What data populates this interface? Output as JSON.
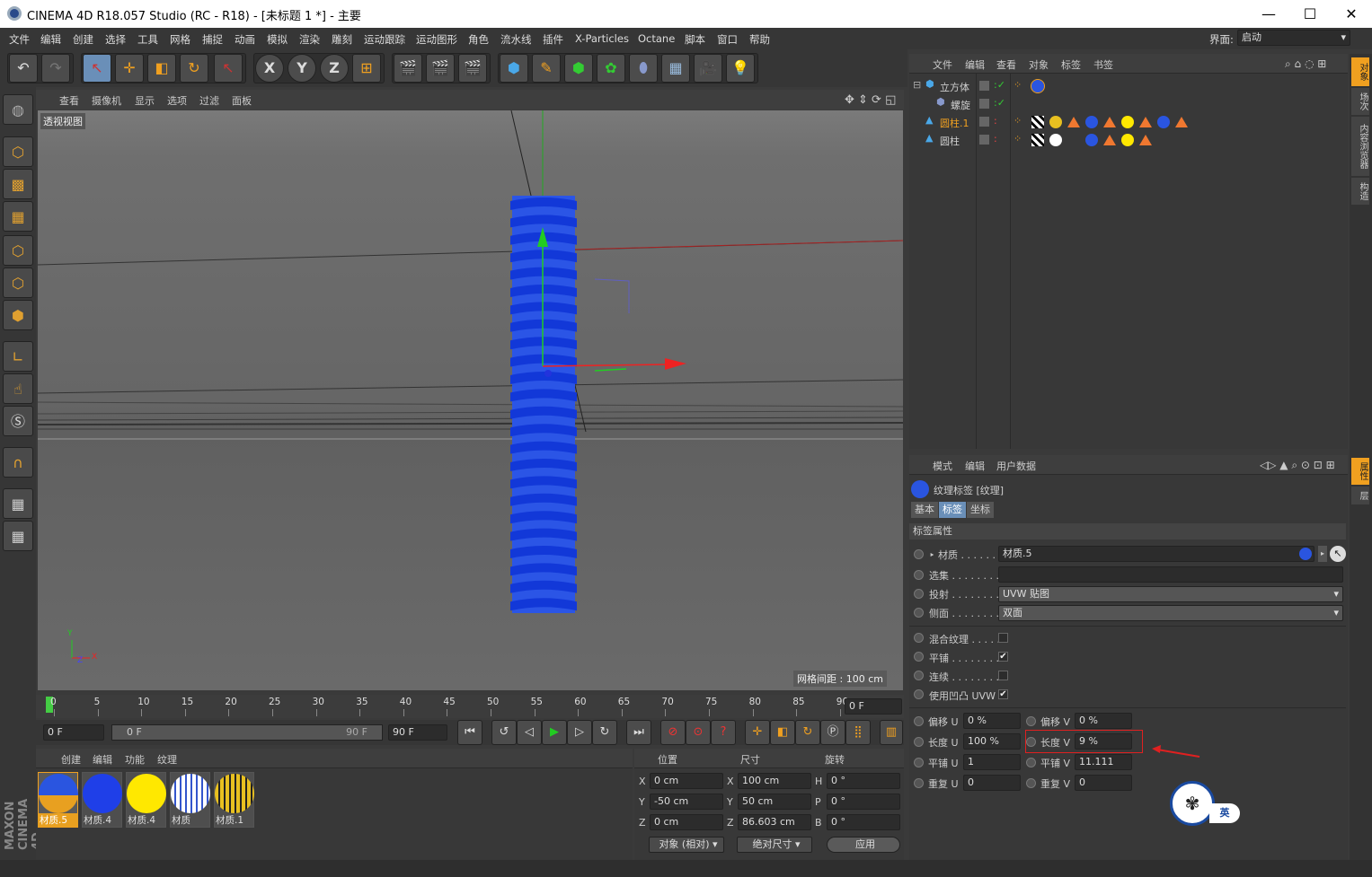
{
  "window": {
    "title": "CINEMA 4D R18.057 Studio (RC - R18) - [未标题 1 *] - 主要",
    "minimize": "—",
    "maximize": "☐",
    "close": "✕"
  },
  "menu": [
    "文件",
    "编辑",
    "创建",
    "选择",
    "工具",
    "网格",
    "捕捉",
    "动画",
    "模拟",
    "渲染",
    "雕刻",
    "运动跟踪",
    "运动图形",
    "角色",
    "流水线",
    "插件",
    "X-Particles",
    "Octane",
    "脚本",
    "窗口",
    "帮助"
  ],
  "layout_label": "界面:",
  "layout_value": "启动",
  "toolbar": {
    "undo": "↶",
    "redo": "↷",
    "select": "↖",
    "move": "✛",
    "scale": "◧",
    "rotate": "↻",
    "live": "↖",
    "x": "X",
    "y": "Y",
    "z": "Z",
    "coord": "⊞"
  },
  "viewport": {
    "menu": [
      "查看",
      "摄像机",
      "显示",
      "选项",
      "过滤",
      "面板"
    ],
    "label": "透视视图",
    "grid_info": "网格间距 : 100 cm",
    "axis_y": "Y",
    "axis_x": "X",
    "axis_z": "Z"
  },
  "timeline": {
    "ticks": [
      "0",
      "5",
      "10",
      "15",
      "20",
      "25",
      "30",
      "35",
      "40",
      "45",
      "50",
      "55",
      "60",
      "65",
      "70",
      "75",
      "80",
      "85",
      "90"
    ],
    "current": "0 F"
  },
  "transport": {
    "start": "0 F",
    "slider_start": "0 F",
    "slider_end": "90 F",
    "end": "90 F"
  },
  "materials": {
    "menu": [
      "创建",
      "编辑",
      "功能",
      "纹理"
    ],
    "items": [
      {
        "name": "材质.5",
        "color": "#2a55e0"
      },
      {
        "name": "材质.4",
        "color": "#1f3fe8"
      },
      {
        "name": "材质.4",
        "color": "#ffe800"
      },
      {
        "name": "材质",
        "color": "#ffffff"
      },
      {
        "name": "材质.1",
        "color": "#e8c020"
      }
    ]
  },
  "coords": {
    "headers": [
      "位置",
      "尺寸",
      "旋转"
    ],
    "rows": [
      {
        "a": "X",
        "pos": "0 cm",
        "b": "X",
        "size": "100 cm",
        "c": "H",
        "rot": "0 °"
      },
      {
        "a": "Y",
        "pos": "-50 cm",
        "b": "Y",
        "size": "50 cm",
        "c": "P",
        "rot": "0 °"
      },
      {
        "a": "Z",
        "pos": "0 cm",
        "b": "Z",
        "size": "86.603 cm",
        "c": "B",
        "rot": "0 °"
      }
    ],
    "mode": "对象 (相对)",
    "size_mode": "绝对尺寸",
    "apply": "应用"
  },
  "objects": {
    "menu": [
      "文件",
      "编辑",
      "查看",
      "对象",
      "标签",
      "书签"
    ],
    "items": [
      {
        "name": "立方体",
        "indent": 0
      },
      {
        "name": "螺旋",
        "indent": 1
      },
      {
        "name": "圆柱.1",
        "indent": 0,
        "active": true
      },
      {
        "name": "圆柱",
        "indent": 0
      }
    ]
  },
  "attributes": {
    "menu": [
      "模式",
      "编辑",
      "用户数据"
    ],
    "title": "纹理标签 [纹理]",
    "tabs": [
      "基本",
      "标签",
      "坐标"
    ],
    "section": "标签属性",
    "rows": [
      {
        "label": "材质",
        "value": "材质.5"
      },
      {
        "label": "选集",
        "value": ""
      },
      {
        "label": "投射",
        "value": "UVW 贴图"
      },
      {
        "label": "侧面",
        "value": "双面"
      }
    ],
    "checks": [
      {
        "label": "混合纹理",
        "checked": ""
      },
      {
        "label": "平铺",
        "checked": "✔"
      },
      {
        "label": "连续",
        "checked": ""
      },
      {
        "label": "使用凹凸 UVW",
        "checked": "✔"
      }
    ],
    "uv": [
      {
        "l1": "偏移 U",
        "v1": "0 %",
        "l2": "偏移 V",
        "v2": "0 %"
      },
      {
        "l1": "长度 U",
        "v1": "100 %",
        "l2": "长度 V",
        "v2": "9 %"
      },
      {
        "l1": "平铺 U",
        "v1": "1",
        "l2": "平铺 V",
        "v2": "11.111"
      },
      {
        "l1": "重复 U",
        "v1": "0",
        "l2": "重复 V",
        "v2": "0"
      }
    ]
  },
  "right_tabs": [
    "对象",
    "场次",
    "内容浏览器",
    "构造"
  ],
  "right_tabs2": [
    "属性",
    "层"
  ],
  "brand": "MAXON CINEMA 4D",
  "ime": "英"
}
